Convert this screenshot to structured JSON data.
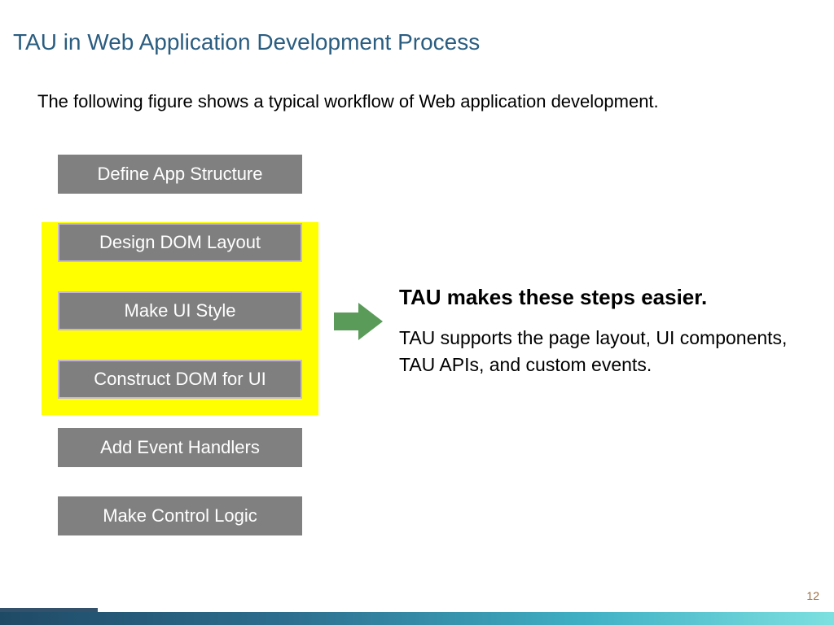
{
  "title": "TAU in Web Application Development Process",
  "intro": "The following figure shows a typical workflow of Web application development.",
  "steps": [
    {
      "label": "Define App Structure",
      "highlight": false
    },
    {
      "label": "Design DOM Layout",
      "highlight": true
    },
    {
      "label": "Make UI Style",
      "highlight": true
    },
    {
      "label": "Construct DOM for UI",
      "highlight": true
    },
    {
      "label": "Add Event Handlers",
      "highlight": false
    },
    {
      "label": "Make Control Logic",
      "highlight": false
    }
  ],
  "callout": {
    "title": "TAU makes these steps easier.",
    "body": "TAU supports the page layout, UI components, TAU APIs, and custom events."
  },
  "page_number": "12",
  "colors": {
    "title": "#2a5d80",
    "step_bg": "#808080",
    "highlight": "#ffff00",
    "arrow": "#5a9b5a"
  }
}
